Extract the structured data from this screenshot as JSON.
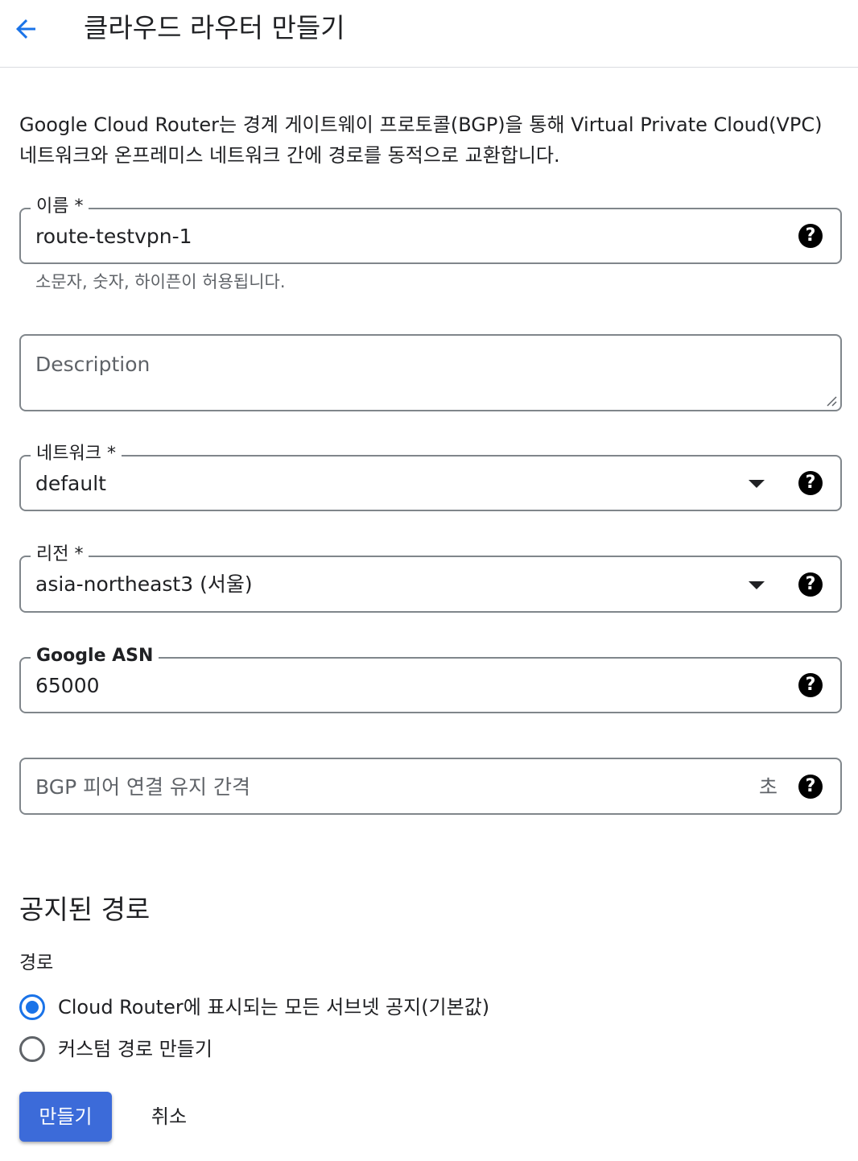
{
  "header": {
    "title": "클라우드 라우터 만들기",
    "back_icon": "arrow-back-icon"
  },
  "intro": "Google Cloud Router는 경계 게이트웨이 프로토콜(BGP)을 통해 Virtual Private Cloud(VPC) 네트워크와 온프레미스 네트워크 간에 경로를 동적으로 교환합니다.",
  "form": {
    "name": {
      "label": "이름 *",
      "value": "route-testvpn-1",
      "hint": "소문자, 숫자, 하이픈이 허용됩니다."
    },
    "description": {
      "placeholder": "Description"
    },
    "network": {
      "label": "네트워크 *",
      "value": "default"
    },
    "region": {
      "label": "리전 *",
      "value": "asia-northeast3 (서울)"
    },
    "asn": {
      "label": "Google ASN",
      "value": "65000"
    },
    "keepalive": {
      "placeholder": "BGP 피어 연결 유지 간격",
      "suffix": "초"
    },
    "help_glyph": "?"
  },
  "routes": {
    "section_title": "공지된 경로",
    "group_label": "경로",
    "options": [
      {
        "label": "Cloud Router에 표시되는 모든 서브넷 공지(기본값)",
        "checked": true
      },
      {
        "label": "커스텀 경로 만들기",
        "checked": false
      }
    ]
  },
  "actions": {
    "create_label": "만들기",
    "cancel_label": "취소"
  },
  "colors": {
    "accent": "#1a73e8",
    "primary_button": "#3c6bd9",
    "border": "#80868b"
  }
}
